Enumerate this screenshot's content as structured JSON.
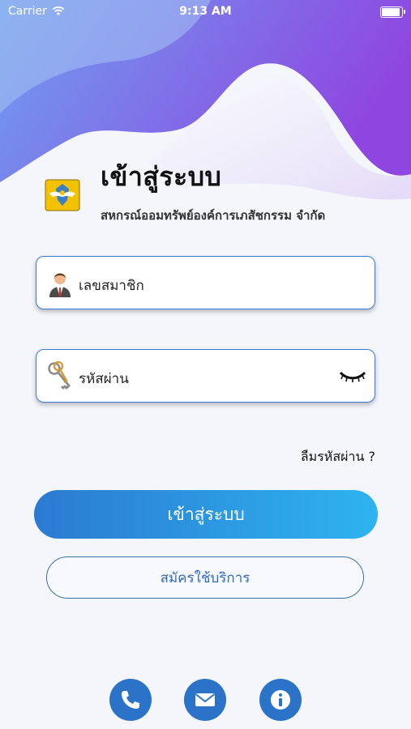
{
  "status_bar": {
    "carrier": "Carrier",
    "time": "9:13 AM"
  },
  "header": {
    "title": "เข้าสู่ระบบ",
    "subtitle": "สหกรณ์ออมทรัพย์องค์การเภสัชกรรม จำกัด"
  },
  "form": {
    "member_placeholder": "เลขสมาชิก",
    "password_placeholder": "รหัสผ่าน",
    "forgot_label": "ลืมรหัสผ่าน ?"
  },
  "actions": {
    "login_label": "เข้าสู่ระบบ",
    "register_label": "สมัครใช้บริการ"
  },
  "footer_icons": [
    "phone-icon",
    "mail-icon",
    "info-icon"
  ],
  "colors": {
    "accent": "#2a73c9",
    "gradient_start": "#2b7ad1",
    "gradient_end": "#2eb3f0"
  }
}
